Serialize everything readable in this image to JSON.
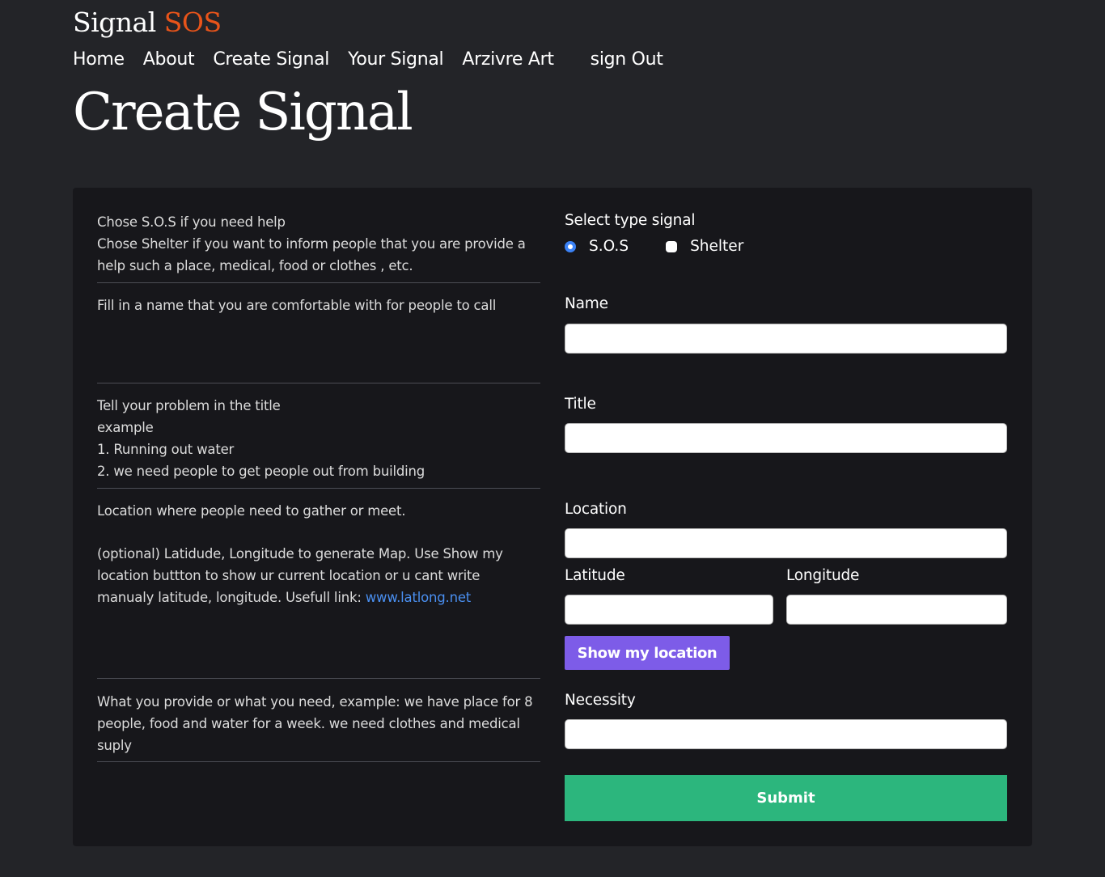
{
  "brand": {
    "name": "Signal",
    "accent": "SOS"
  },
  "nav": {
    "items": [
      "Home",
      "About",
      "Create Signal",
      "Your Signal",
      "Arzivre Art"
    ],
    "sign_out": "sign Out"
  },
  "page": {
    "title": "Create Signal"
  },
  "help": {
    "type": [
      "Chose S.O.S if you need help",
      "Chose Shelter if you want to inform people that you are provide a help such a place, medical, food or clothes , etc."
    ],
    "name": "Fill in a name that you are comfortable with for people to call",
    "title": [
      "Tell your problem in the title",
      "example",
      "1. Running out water",
      "2. we need people to get people out from building"
    ],
    "location": "Location where people need to gather or meet.",
    "coords": "(optional) Latidude, Longitude to generate Map. Use Show my location buttton to show ur current location or u cant write manualy latitude, longitude. Usefull link:",
    "coords_link": "www.latlong.net",
    "necessity": "What you provide or what you need, example: we have place for 8 people, food and water for a week. we need clothes and medical suply"
  },
  "form": {
    "type_label": "Select type signal",
    "type_options": [
      {
        "label": "S.O.S",
        "selected": true
      },
      {
        "label": "Shelter",
        "selected": false
      }
    ],
    "name_label": "Name",
    "name_value": "",
    "title_label": "Title",
    "title_value": "",
    "location_label": "Location",
    "location_value": "",
    "latitude_label": "Latitude",
    "latitude_value": "",
    "longitude_label": "Longitude",
    "longitude_value": "",
    "show_location_button": "Show my location",
    "necessity_label": "Necessity",
    "necessity_value": "",
    "submit_button": "Submit"
  },
  "colors": {
    "accent": "#e8541a",
    "location_button": "#7d5ce8",
    "submit_button": "#2cb67d",
    "link": "#4a8ff0",
    "radio": "#3b82f6"
  }
}
